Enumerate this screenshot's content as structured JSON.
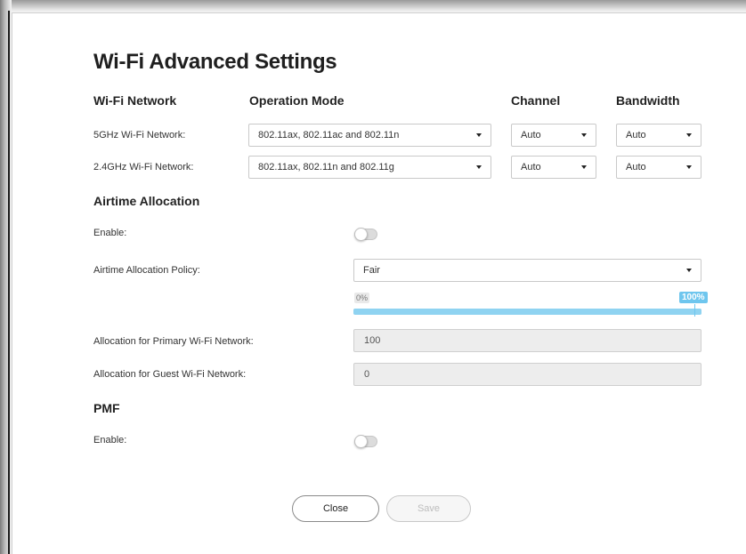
{
  "dialog": {
    "title": "Wi-Fi Advanced Settings"
  },
  "wifi": {
    "headers": {
      "network": "Wi-Fi Network",
      "mode": "Operation Mode",
      "channel": "Channel",
      "bandwidth": "Bandwidth"
    },
    "rows": [
      {
        "label": "5GHz Wi-Fi Network:",
        "mode": "802.11ax, 802.11ac and 802.11n",
        "channel": "Auto",
        "bandwidth": "Auto"
      },
      {
        "label": "2.4GHz Wi-Fi Network:",
        "mode": "802.11ax, 802.11n and 802.11g",
        "channel": "Auto",
        "bandwidth": "Auto"
      }
    ]
  },
  "airtime": {
    "title": "Airtime Allocation",
    "enable_label": "Enable:",
    "enabled": false,
    "policy_label": "Airtime Allocation Policy:",
    "policy_value": "Fair",
    "slider": {
      "min_label": "0%",
      "max_label": "100%",
      "value": 100
    },
    "primary_label": "Allocation for Primary Wi-Fi Network:",
    "primary_value": "100",
    "guest_label": "Allocation for Guest Wi-Fi Network:",
    "guest_value": "0"
  },
  "pmf": {
    "title": "PMF",
    "enable_label": "Enable:",
    "enabled": false
  },
  "buttons": {
    "close": "Close",
    "save": "Save"
  },
  "colors": {
    "accent": "#8fd3f1",
    "accent_strong": "#6fc6ee"
  }
}
